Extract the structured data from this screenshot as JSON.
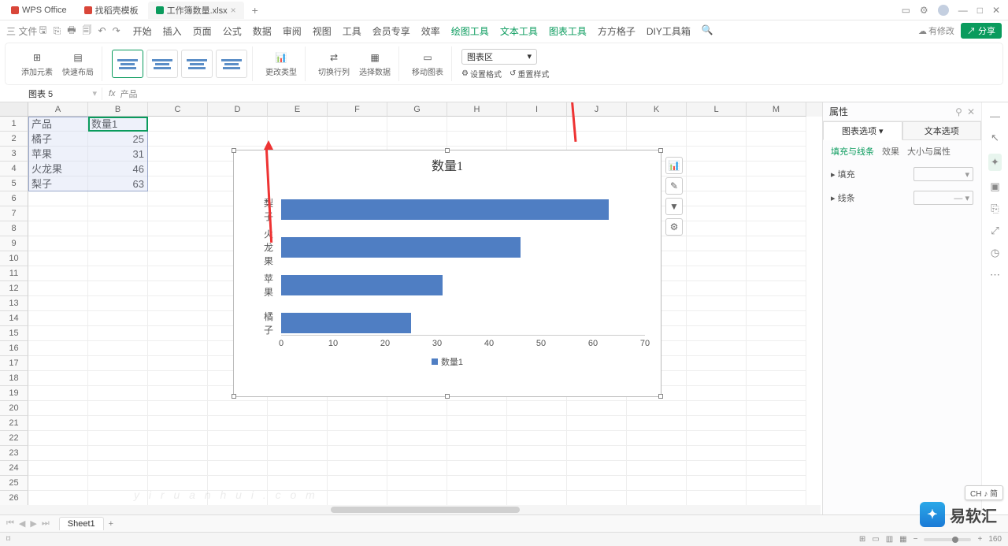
{
  "title_tabs": {
    "wps": "WPS Office",
    "tab1": "找稻壳模板",
    "tab2": "工作簿数量.xlsx"
  },
  "menu": {
    "file": "三 文件",
    "items": [
      "开始",
      "插入",
      "页面",
      "公式",
      "数据",
      "审阅",
      "视图",
      "工具",
      "会员专享",
      "效率",
      "绘图工具",
      "文本工具",
      "图表工具",
      "方方格子",
      "DIY工具箱"
    ],
    "modify": "有修改",
    "share": "分享"
  },
  "ribbon": {
    "add_element": "添加元素",
    "quick_layout": "快速布局",
    "change_type": "更改类型",
    "switch_rc": "切换行列",
    "select_data": "选择数据",
    "move_chart": "移动图表",
    "region_sel": "图表区",
    "set_format": "设置格式",
    "reset_style": "重置样式"
  },
  "formula": {
    "name": "图表 5",
    "fx": "fx",
    "val": "产品"
  },
  "cols": [
    "A",
    "B",
    "C",
    "D",
    "E",
    "F",
    "G",
    "H",
    "I",
    "J",
    "K",
    "L",
    "M"
  ],
  "cells": {
    "A1": "产品",
    "B1": "数量1",
    "A2": "橘子",
    "B2": "25",
    "A3": "苹果",
    "B3": "31",
    "A4": "火龙果",
    "B4": "46",
    "A5": "梨子",
    "B5": "63"
  },
  "chart_data": {
    "type": "bar",
    "title": "数量1",
    "categories": [
      "梨子",
      "火龙果",
      "苹果",
      "橘子"
    ],
    "values": [
      63,
      46,
      31,
      25
    ],
    "x_ticks": [
      0,
      10,
      20,
      30,
      40,
      50,
      60,
      70
    ],
    "xmax": 70,
    "legend": "数量1"
  },
  "right": {
    "prop": "属性",
    "tab1": "图表选项",
    "tab2": "文本选项",
    "sub1": "填充与线条",
    "sub2": "效果",
    "sub3": "大小与属性",
    "fill": "填充",
    "line": "线条"
  },
  "sheet": {
    "name": "Sheet1"
  },
  "status": {
    "zoom": "160",
    "ime": "CH ♪ 简"
  },
  "watermark": {
    "brand": "易软汇"
  }
}
